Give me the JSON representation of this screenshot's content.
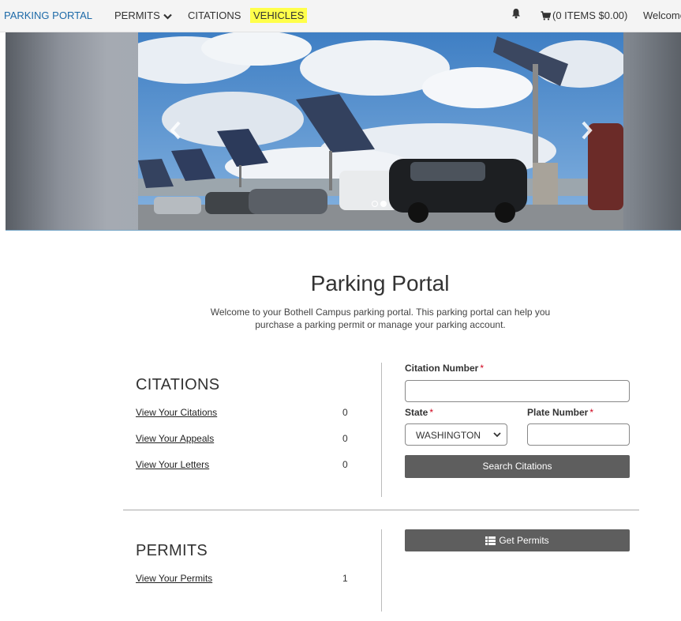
{
  "nav": {
    "brand": "PARKING PORTAL",
    "permits": "PERMITS",
    "citations": "CITATIONS",
    "vehicles": "VEHICLES",
    "cart": "(0 ITEMS $0.00)",
    "welcome": "Welcome,",
    "highlight_color": "#ffff4a",
    "brand_color": "#1d6aa8"
  },
  "hero": {
    "slide_count": 2,
    "active_slide": 2
  },
  "main": {
    "title": "Parking Portal",
    "intro": "Welcome to your Bothell Campus parking portal. This parking portal can help you purchase a parking permit or manage your parking account."
  },
  "citations": {
    "heading": "CITATIONS",
    "links": [
      {
        "label": "View Your Citations",
        "count": "0"
      },
      {
        "label": "View Your Appeals",
        "count": "0"
      },
      {
        "label": "View Your Letters",
        "count": "0"
      }
    ]
  },
  "citation_form": {
    "citation_number_label": "Citation Number",
    "citation_number_value": "",
    "state_label": "State",
    "state_value": "WASHINGTON",
    "plate_label": "Plate Number",
    "plate_value": "",
    "required_mark": "*",
    "search_button": "Search Citations"
  },
  "permits": {
    "heading": "PERMITS",
    "links": [
      {
        "label": "View Your Permits",
        "count": "1"
      }
    ],
    "get_button": "Get Permits"
  }
}
